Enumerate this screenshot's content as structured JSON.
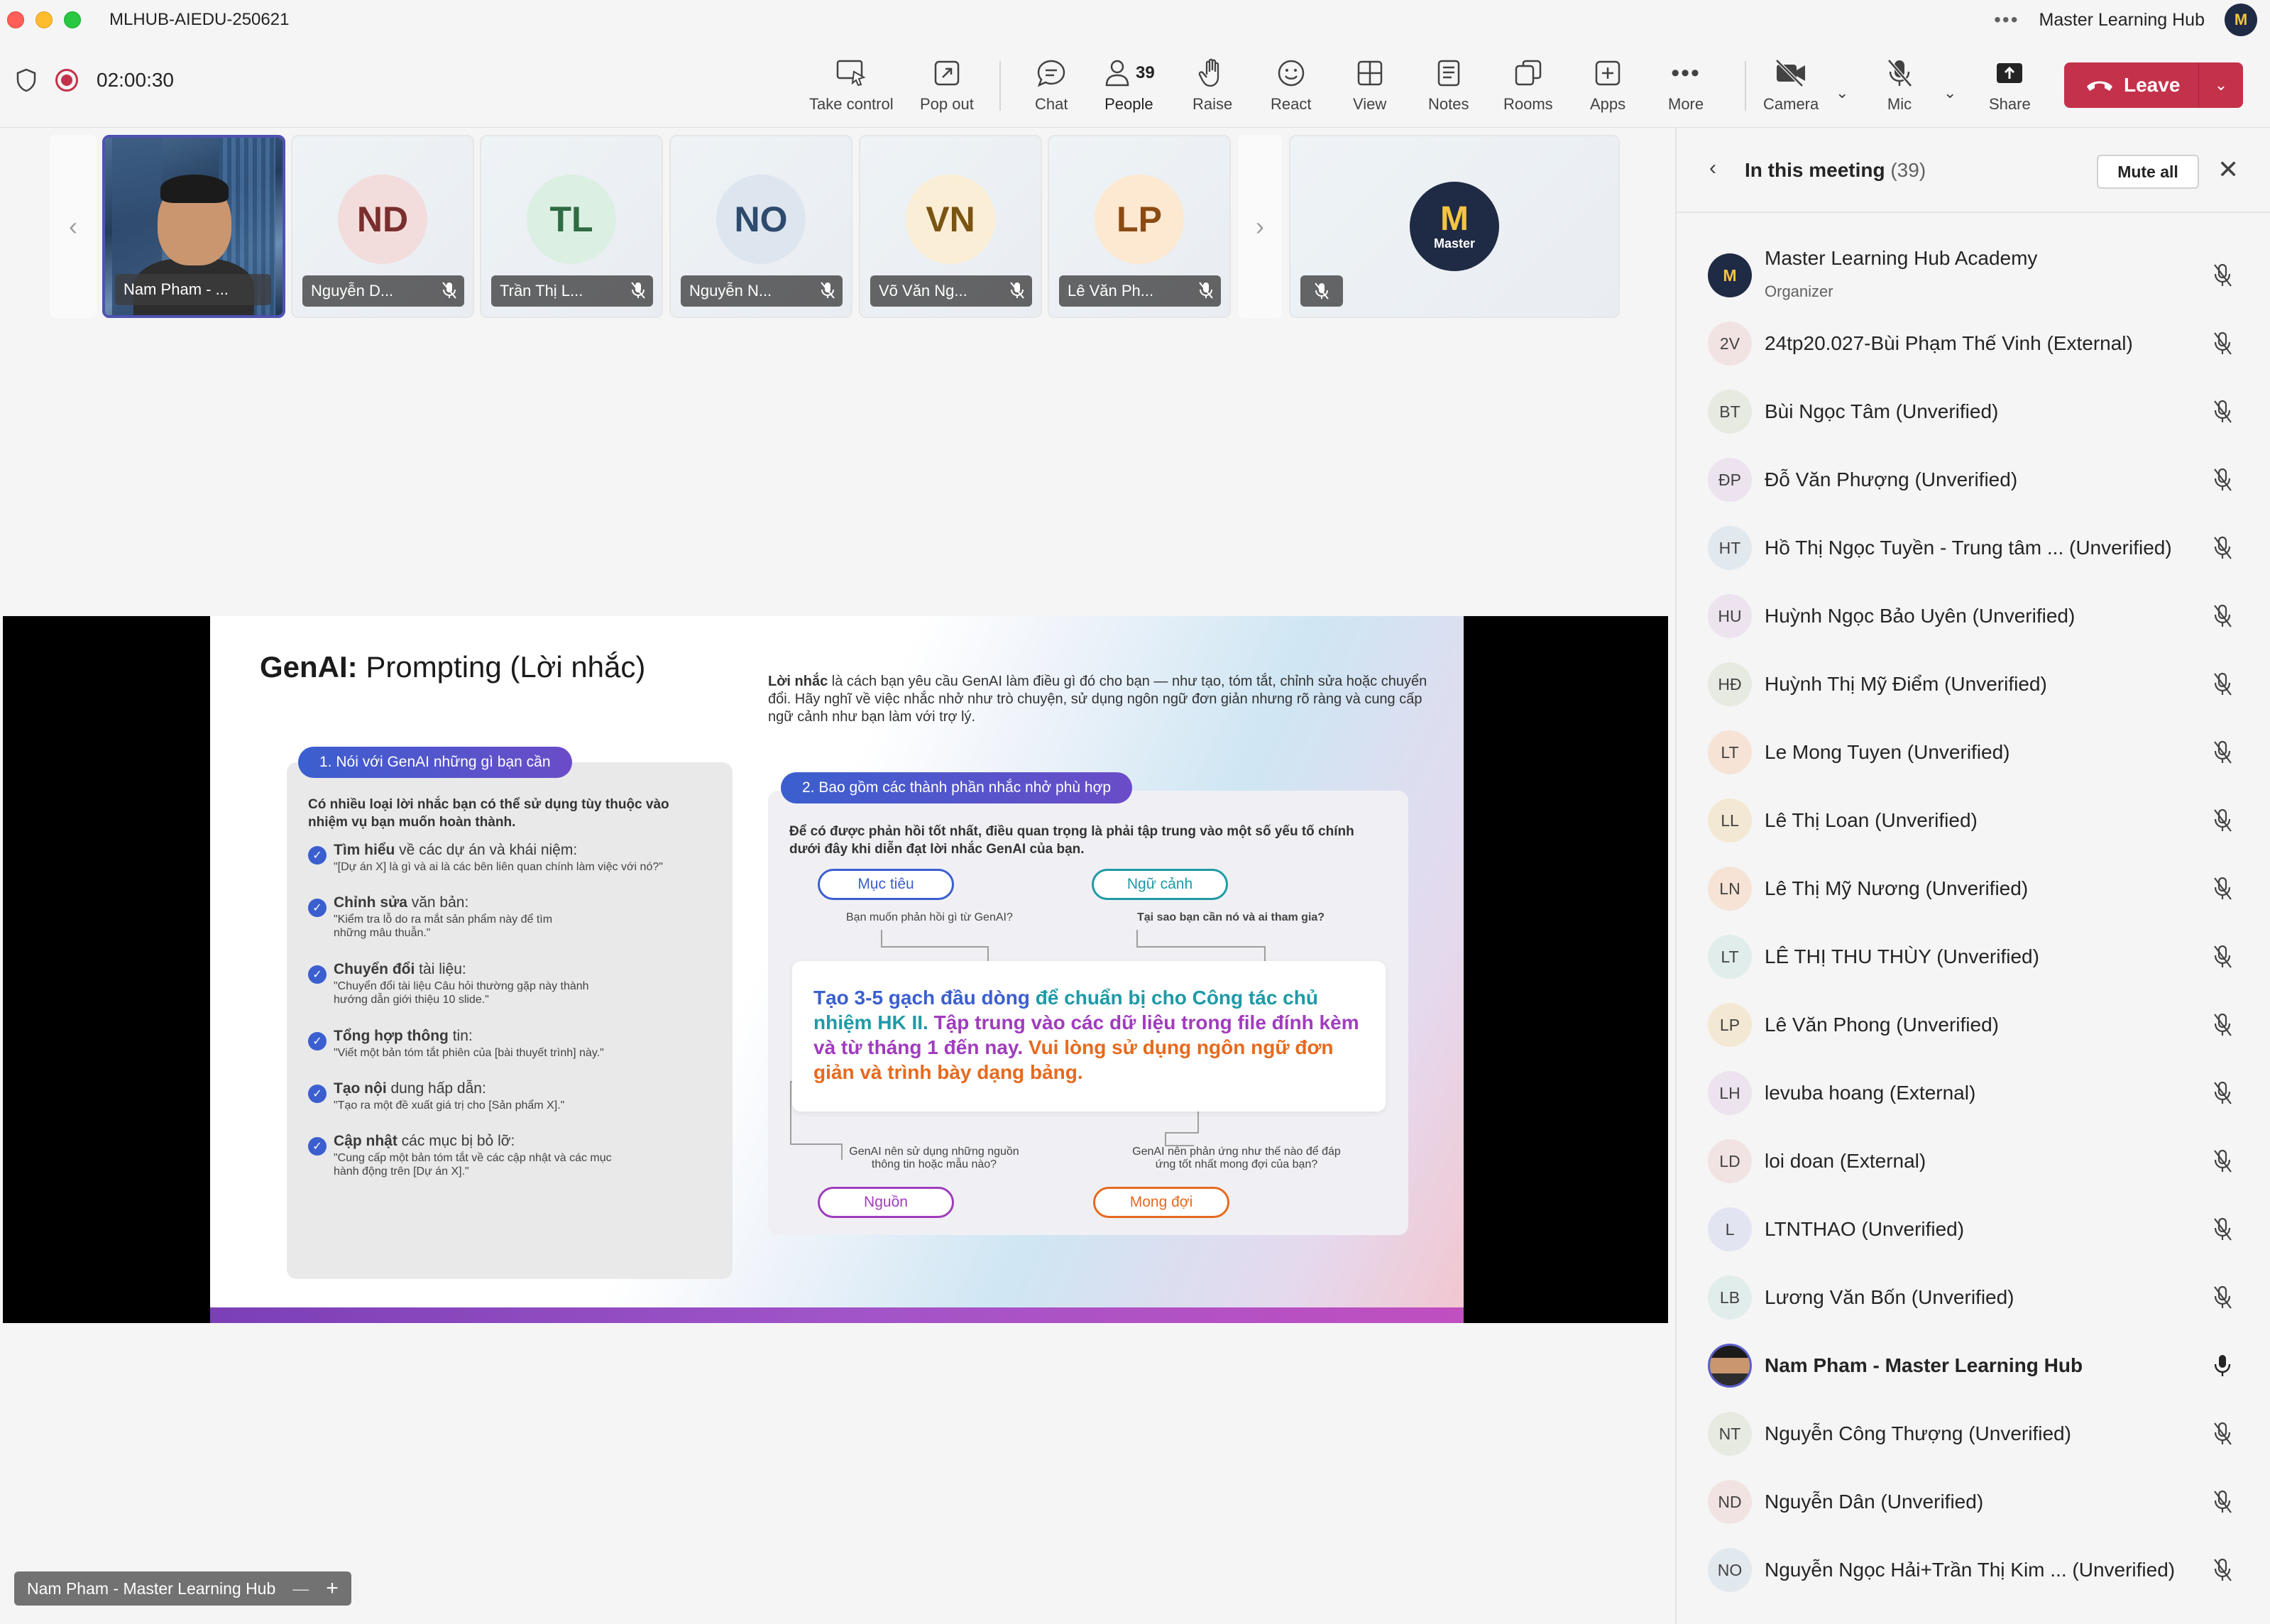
{
  "window": {
    "title": "MLHUB-AIEDU-250621",
    "org_name": "Master Learning Hub",
    "org_avatar_text": "M"
  },
  "toolbar": {
    "timer": "02:00:30",
    "take_control": "Take control",
    "pop_out": "Pop out",
    "chat": "Chat",
    "people": "People",
    "people_count": "39",
    "raise": "Raise",
    "react": "React",
    "view": "View",
    "notes": "Notes",
    "rooms": "Rooms",
    "apps": "Apps",
    "more": "More",
    "camera": "Camera",
    "mic": "Mic",
    "share": "Share",
    "leave": "Leave"
  },
  "gallery": [
    {
      "initials": "",
      "name": "Nam Pham - ...",
      "video": true
    },
    {
      "initials": "ND",
      "name": "Nguyễn D...",
      "bg": "#f3dcdc",
      "fg": "#7a2e2e"
    },
    {
      "initials": "TL",
      "name": "Trần Thị L...",
      "bg": "#dcefe3",
      "fg": "#2f6b43"
    },
    {
      "initials": "NO",
      "name": "Nguyễn N...",
      "bg": "#dde5ef",
      "fg": "#2e4b6e"
    },
    {
      "initials": "VN",
      "name": "Võ Văn Ng...",
      "bg": "#fbeed6",
      "fg": "#7a5412"
    },
    {
      "initials": "LP",
      "name": "Lê Văn Ph...",
      "bg": "#fde8d1",
      "fg": "#8a4b12"
    },
    {
      "initials": "",
      "name": "",
      "logo_text_top": "M",
      "logo_text_bottom": "Master"
    }
  ],
  "slide": {
    "title_bold": "GenAI:",
    "title_rest": " Prompting (Lời nhắc)",
    "intro_bold": "Lời nhắc",
    "intro_rest": " là cách bạn yêu cầu GenAI làm điều gì đó cho bạn — như tạo, tóm tắt, chỉnh sửa hoặc chuyển đổi. Hãy nghĩ về việc nhắc nhở như trò chuyện, sử dụng ngôn ngữ đơn giản nhưng rõ ràng và cung cấp ngữ cảnh như bạn làm với trợ lý.",
    "panel1": {
      "pill": "1. Nói với GenAI những gì bạn cần",
      "intro": "Có nhiều loại lời nhắc bạn có thể sử dụng tùy thuộc vào nhiệm vụ bạn muốn hoàn thành.",
      "items": [
        {
          "bold": "Tìm hiểu",
          "rest": " về các dự án và khái niệm:",
          "desc": "\"[Dự án X] là gì và ai là các bên liên quan chính làm việc với nó?\""
        },
        {
          "bold": "Chỉnh sửa",
          "rest": " văn bản:",
          "desc": "\"Kiểm tra lỗ do ra mắt sản phẩm này để tìm những mâu thuẫn.\""
        },
        {
          "bold": "Chuyển đổi",
          "rest": " tài liệu:",
          "desc": "\"Chuyển đổi tài liệu Câu hỏi thường gặp này thành hướng dẫn giới thiệu 10 slide.\""
        },
        {
          "bold": "Tổng hợp thông",
          "rest": " tin:",
          "desc": "\"Viết một bản tóm tắt phiên của [bài thuyết trình] này.\""
        },
        {
          "bold": "Tạo nội",
          "rest": " dung hấp dẫn:",
          "desc": "\"Tạo ra một đề xuất giá trị cho [Sản phẩm X].\""
        },
        {
          "bold": "Cập nhật",
          "rest": " các mục bị bỏ lỡ:",
          "desc": "\"Cung cấp một bản tóm tắt về các cập nhật và các mục hành động trên [Dự án X].\""
        }
      ]
    },
    "panel2": {
      "pill": "2. Bao gồm các thành phần nhắc nhở phù hợp",
      "intro": "Để có được phản hồi tốt nhất, điều quan trọng là phải tập trung vào một số yếu tố chính dưới đây khi diễn đạt lời nhắc GenAI của bạn.",
      "tag_goal": "Mục tiêu",
      "tag_goal_q": "Bạn muốn phản hồi gì từ GenAI?",
      "tag_context": "Ngữ cảnh",
      "tag_context_q": "Tại sao bạn cần nó và ai tham gia?",
      "tag_source": "Nguồn",
      "tag_source_q": "GenAI nên sử dụng những nguồn thông tin hoặc mẫu nào?",
      "tag_expect": "Mong đợi",
      "tag_expect_q": "GenAI nên phản ứng như thế nào để đáp ứng tốt nhất mong đợi của bạn?",
      "prompt_1": "Tạo 3-5 gạch đầu dòng",
      "prompt_2": " để chuẩn bị cho Công tác chủ nhiệm HK II.",
      "prompt_3": " Tập trung vào các dữ liệu trong file đính kèm và từ tháng 1 đến nay.",
      "prompt_4": " Vui lòng sử dụng ngôn ngữ đơn giản và trình bày dạng bảng."
    }
  },
  "presenter_label": "Nam Pham - Master Learning Hub",
  "panel": {
    "title": "In this meeting",
    "count": "(39)",
    "mute_all": "Mute all",
    "participants": [
      {
        "initials": "M",
        "name": "Master Learning Hub Academy",
        "sub": "Organizer",
        "logo": true
      },
      {
        "initials": "2V",
        "name": "24tp20.027-Bùi Phạm Thế Vinh (External)",
        "bg": "#f2e3e3"
      },
      {
        "initials": "BT",
        "name": "Bùi Ngọc Tâm (Unverified)",
        "bg": "#e6eae1"
      },
      {
        "initials": "ĐP",
        "name": "Đỗ Văn Phượng (Unverified)",
        "bg": "#ece3ef"
      },
      {
        "initials": "HT",
        "name": "Hồ Thị Ngọc Tuyền - Trung tâm ... (Unverified)",
        "bg": "#e1e8ee"
      },
      {
        "initials": "HU",
        "name": "Huỳnh Ngọc Bảo Uyên (Unverified)",
        "bg": "#ece3ef"
      },
      {
        "initials": "HĐ",
        "name": "Huỳnh Thị Mỹ Điểm (Unverified)",
        "bg": "#e6eae1"
      },
      {
        "initials": "LT",
        "name": "Le Mong Tuyen (Unverified)",
        "bg": "#f6e3d6"
      },
      {
        "initials": "LL",
        "name": "Lê Thị Loan (Unverified)",
        "bg": "#f3e8d3"
      },
      {
        "initials": "LN",
        "name": "Lê Thị Mỹ Nương (Unverified)",
        "bg": "#f6e3d6"
      },
      {
        "initials": "LT",
        "name": "LÊ THỊ THU THÙY (Unverified)",
        "bg": "#e1edea"
      },
      {
        "initials": "LP",
        "name": "Lê Văn Phong (Unverified)",
        "bg": "#f3e8d3"
      },
      {
        "initials": "LH",
        "name": "levuba hoang (External)",
        "bg": "#ece3ef"
      },
      {
        "initials": "LD",
        "name": "loi doan (External)",
        "bg": "#f2e3e3"
      },
      {
        "initials": "L",
        "name": "LTNTHAO (Unverified)",
        "bg": "#e3e4f2"
      },
      {
        "initials": "LB",
        "name": "Lương Văn Bốn (Unverified)",
        "bg": "#e1edea"
      },
      {
        "initials": "",
        "name": "Nam Pham - Master Learning Hub",
        "bold": true,
        "photo": true,
        "mic_on": true
      },
      {
        "initials": "NT",
        "name": "Nguyễn Công Thượng (Unverified)",
        "bg": "#e6eae1"
      },
      {
        "initials": "ND",
        "name": "Nguyễn Dân (Unverified)",
        "bg": "#f2e3e3"
      },
      {
        "initials": "NO",
        "name": "Nguyễn Ngọc Hải+Trần Thị Kim ... (Unverified)",
        "bg": "#e1e8ee"
      }
    ]
  },
  "colors": {
    "accent": "#5b5fc7",
    "leave": "#c4314b",
    "record": "#c4314b"
  }
}
